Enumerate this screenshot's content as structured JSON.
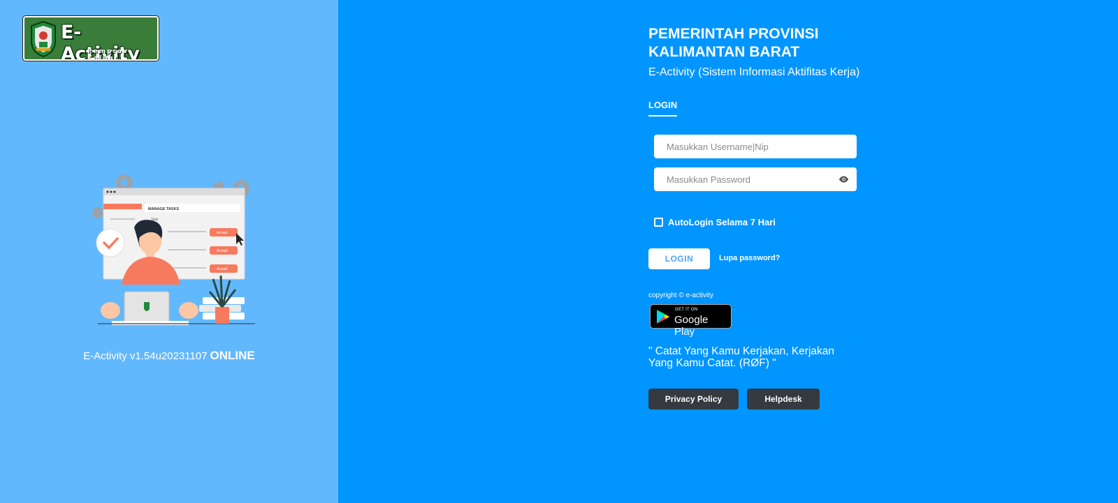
{
  "brand": {
    "logo_title": "E-Activity",
    "logo_subtitle": "Pemprov Kalbar"
  },
  "left_panel": {
    "version": "E-Activity v1.54u20231107",
    "status": "ONLINE",
    "illustration": {
      "header": "MANAGE TASKS",
      "tab": "Task",
      "action_labels": [
        "Accept",
        "Accept",
        "Accept"
      ]
    }
  },
  "header": {
    "title": "PEMERINTAH PROVINSI KALIMANTAN BARAT",
    "subtitle": "E-Activity (Sistem Informasi Aktifitas Kerja)"
  },
  "login_form": {
    "tab_label": "LOGIN",
    "username_placeholder": "Masukkan Username|Nip",
    "password_placeholder": "Masukkan Password",
    "autologin_label": "AutoLogin Selama 7 Hari",
    "autologin_checked": false,
    "submit_label": "LOGIN",
    "forgot_label": "Lupa password?"
  },
  "footer": {
    "copyright": "copyright © e-activity",
    "google_play_top": "GET IT ON",
    "google_play_store": "Google Play",
    "quote": "\" Catat Yang Kamu Kerjakan, Kerjakan Yang Kamu Catat. (RØF) \"",
    "privacy_label": "Privacy Policy",
    "helpdesk_label": "Helpdesk"
  },
  "colors": {
    "left_panel_bg": "#62b8fc",
    "right_panel_bg": "#0095ff",
    "dark_button": "#343a40",
    "accept_button": "#f87a5e"
  }
}
